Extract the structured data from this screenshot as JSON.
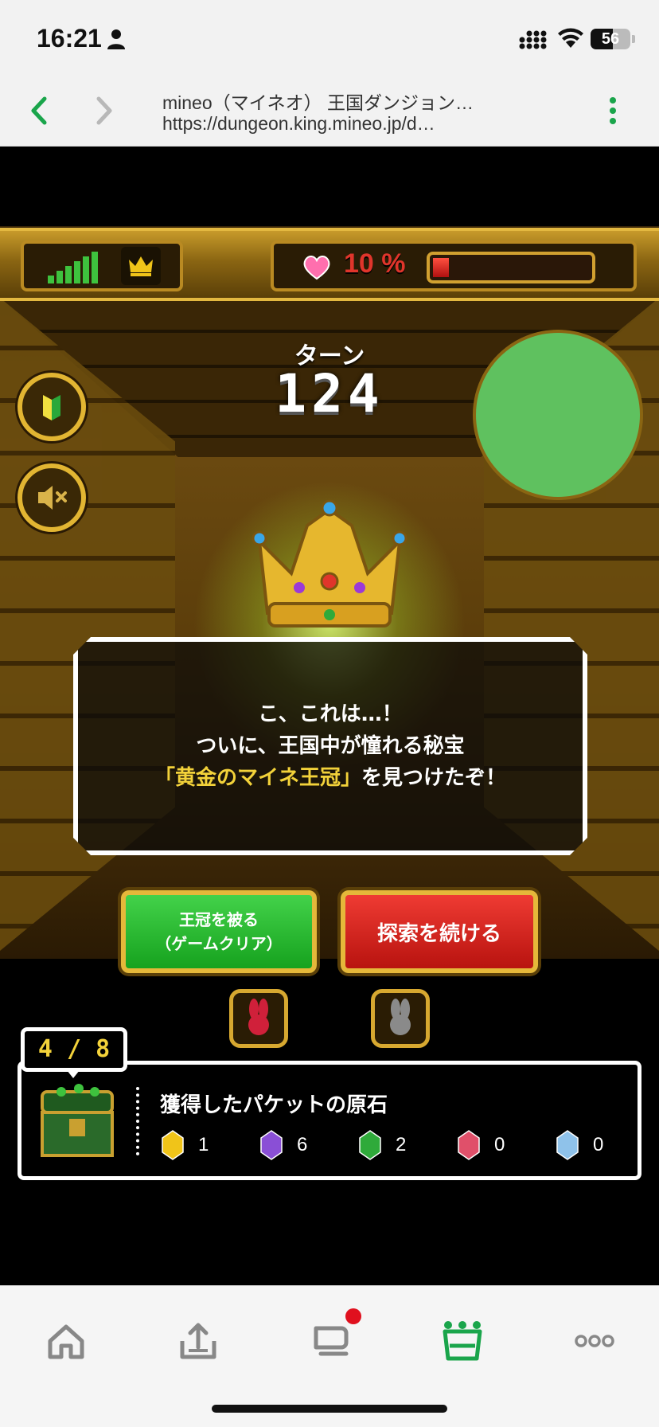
{
  "status_bar": {
    "time": "16:21",
    "battery": "56",
    "battery_level": 0.56
  },
  "browser": {
    "title": "mineo（マイネオ） 王国ダンジョン…",
    "url": "https://dungeon.king.mineo.jp/d…"
  },
  "game": {
    "hp_percent": "10 %",
    "hp_level": 0.1,
    "turn_label": "ターン",
    "turn_number": "124",
    "dialog": {
      "line1": "こ、これは…！",
      "line2": "ついに、王国中が憧れる秘宝",
      "line3_highlight": "「黄金のマイネ王冠」",
      "line3_rest": "を見つけたぞ！"
    },
    "crown_button": {
      "line1": "王冠を被る",
      "line2": "（ゲームクリア）"
    },
    "explore_button": "探索を続ける",
    "counter": "4 / 8",
    "gem_panel": {
      "title": "獲得したパケットの原石",
      "gems": [
        {
          "color": "#f0c419",
          "count": "1"
        },
        {
          "color": "#8a4fd6",
          "count": "6"
        },
        {
          "color": "#2faa3a",
          "count": "2"
        },
        {
          "color": "#e0506a",
          "count": "0"
        },
        {
          "color": "#8fc2ea",
          "count": "0"
        }
      ]
    }
  },
  "colors": {
    "accent_green": "#1aa54b",
    "hp_red": "#e0352b",
    "gold": "#e3b840"
  }
}
